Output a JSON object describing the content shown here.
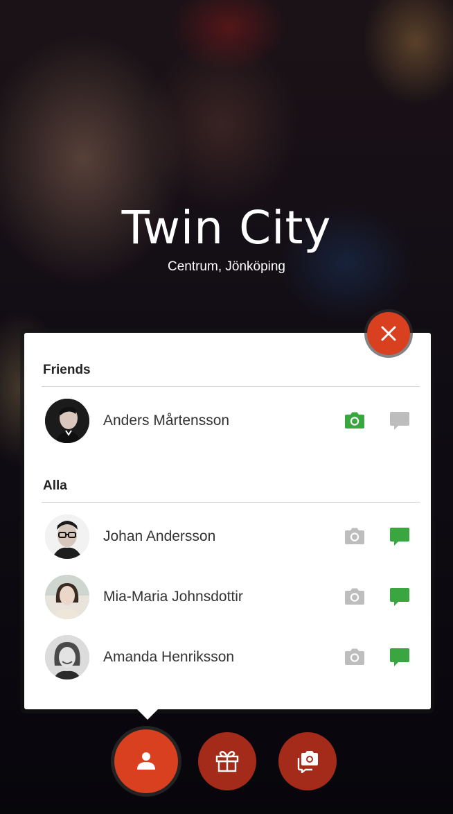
{
  "venue": {
    "title": "Twin City",
    "subtitle": "Centrum, Jönköping"
  },
  "colors": {
    "accent": "#d9401f",
    "accent_dark": "#a42b1a",
    "active_icon": "#3aa640",
    "inactive_icon": "#bdbdbd"
  },
  "friends_section": {
    "header": "Friends",
    "people": [
      {
        "name": "Anders Mårtensson",
        "camera_active": true,
        "chat_active": false
      }
    ]
  },
  "all_section": {
    "header": "Alla",
    "people": [
      {
        "name": "Johan Andersson",
        "camera_active": false,
        "chat_active": true
      },
      {
        "name": "Mia-Maria Johnsdottir",
        "camera_active": false,
        "chat_active": true
      },
      {
        "name": "Amanda Henriksson",
        "camera_active": false,
        "chat_active": true
      }
    ]
  },
  "icons": {
    "close": "close-icon",
    "person": "person-icon",
    "gift": "gift-icon",
    "photo_chat": "photo-chat-icon",
    "camera": "camera-icon",
    "chat": "chat-bubble-icon"
  }
}
